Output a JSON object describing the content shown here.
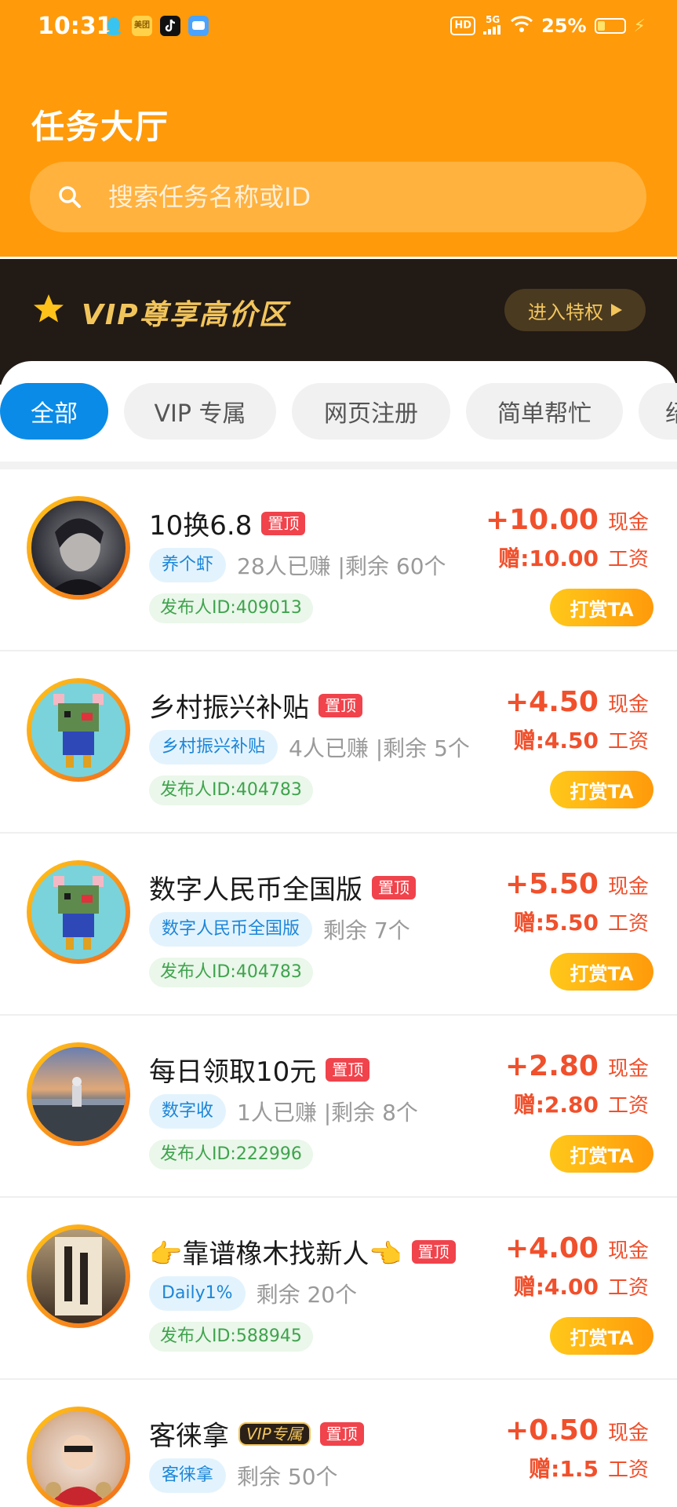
{
  "status_bar": {
    "time": "10:31",
    "battery": "25%",
    "network": "5G",
    "hd": "HD",
    "app_icons": [
      "qq-icon",
      "meituan-icon",
      "douyin-icon",
      "app-icon"
    ],
    "app_icon_label_meituan": "美团"
  },
  "header": {
    "title": "任务大厅",
    "search_placeholder": "搜索任务名称或ID"
  },
  "vip": {
    "title": "VIP尊享高价区",
    "button": "进入特权",
    "accent": "#F2C55C"
  },
  "tabs": [
    {
      "label": "全部",
      "active": true
    },
    {
      "label": "VIP 专属"
    },
    {
      "label": "网页注册"
    },
    {
      "label": "简单帮忙"
    },
    {
      "label": "绍"
    }
  ],
  "tasks": [
    {
      "title": "10换6.8",
      "top_badge": "置顶",
      "tag": "养个虾",
      "stats": "28人已赚 |剩余 60个",
      "publisher": "发布人ID:409013",
      "amount": "+10.00",
      "amount_label": "现金",
      "gift": "赠:10.00",
      "gift_label": "工资",
      "button": "打赏TA"
    },
    {
      "title": "乡村振兴补贴",
      "top_badge": "置顶",
      "tag": "乡村振兴补贴",
      "stats": "4人已赚 |剩余 5个",
      "publisher": "发布人ID:404783",
      "amount": "+4.50",
      "amount_label": "现金",
      "gift": "赠:4.50",
      "gift_label": "工资",
      "button": "打赏TA"
    },
    {
      "title": "数字人民币全国版",
      "top_badge": "置顶",
      "tag": "数字人民币全国版",
      "stats": "剩余 7个",
      "publisher": "发布人ID:404783",
      "amount": "+5.50",
      "amount_label": "现金",
      "gift": "赠:5.50",
      "gift_label": "工资",
      "button": "打赏TA"
    },
    {
      "title": "每日领取10元",
      "top_badge": "置顶",
      "tag": "数字收",
      "stats": "1人已赚 |剩余 8个",
      "publisher": "发布人ID:222996",
      "amount": "+2.80",
      "amount_label": "现金",
      "gift": "赠:2.80",
      "gift_label": "工资",
      "button": "打赏TA"
    },
    {
      "title": "👉靠谱橡木找新人👈",
      "top_badge": "置顶",
      "tag": "Daily1%",
      "stats": "剩余 20个",
      "publisher": "发布人ID:588945",
      "amount": "+4.00",
      "amount_label": "现金",
      "gift": "赠:4.00",
      "gift_label": "工资",
      "button": "打赏TA"
    },
    {
      "title": "客徕拿",
      "vip_badge": "VIP专属",
      "top_badge": "置顶",
      "tag": "客徕拿",
      "stats": "剩余 50个",
      "amount": "+0.50",
      "amount_label": "现金",
      "gift": "赠:1.5",
      "gift_label": "工资"
    }
  ],
  "colors": {
    "header_orange": "#FF9A0A",
    "vip_dark": "#221A15",
    "tab_active": "#0A8BE8",
    "amount_red": "#F0502C",
    "top_badge": "#F0434B"
  }
}
